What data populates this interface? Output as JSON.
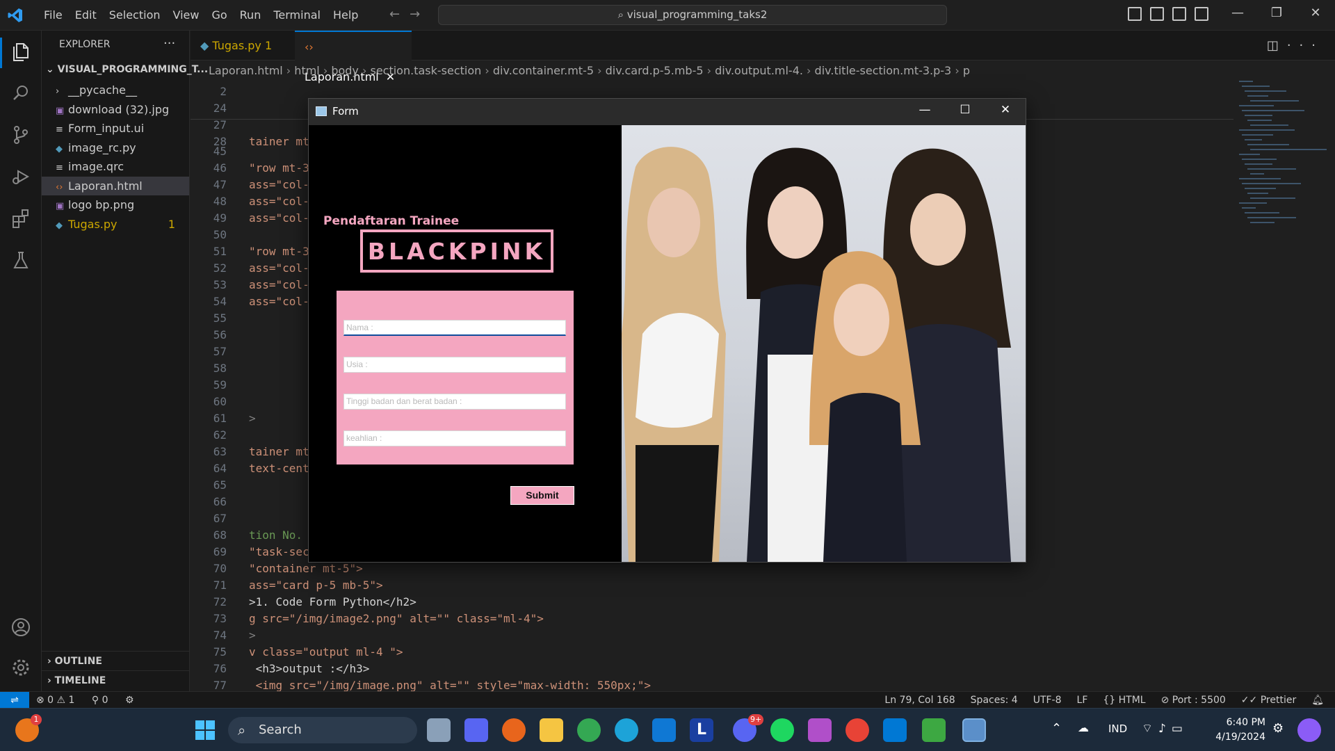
{
  "app": {
    "menu": [
      "File",
      "Edit",
      "Selection",
      "View",
      "Go",
      "Run",
      "Terminal",
      "Help"
    ],
    "search_text": "visual_programming_taks2"
  },
  "sidebar": {
    "header": "EXPLORER",
    "project": "VISUAL_PROGRAMMING_T...",
    "files": [
      {
        "name": "__pycache__",
        "icon": "chevron-right",
        "badge": ""
      },
      {
        "name": "download (32).jpg",
        "icon": "image",
        "badge": ""
      },
      {
        "name": "Form_input.ui",
        "icon": "lines",
        "badge": ""
      },
      {
        "name": "image_rc.py",
        "icon": "python",
        "badge": ""
      },
      {
        "name": "image.qrc",
        "icon": "lines",
        "badge": ""
      },
      {
        "name": "Laporan.html",
        "icon": "html",
        "badge": ""
      },
      {
        "name": "logo bp.png",
        "icon": "image",
        "badge": ""
      },
      {
        "name": "Tugas.py",
        "icon": "python",
        "badge": "1"
      }
    ],
    "outline": "OUTLINE",
    "timeline": "TIMELINE"
  },
  "tabs": [
    {
      "label": "Tugas.py 1"
    },
    {
      "label": "Laporan.html"
    }
  ],
  "breadcrumb": [
    "Laporan.html",
    "html",
    "body",
    "section.task-section",
    "div.container.mt-5",
    "div.card.p-5.mb-5",
    "div.output.ml-4.",
    "div.title-section.mt-3.p-3",
    "p"
  ],
  "code_lines": [
    {
      "n": "2",
      "t": ""
    },
    {
      "n": "24",
      "t": ""
    },
    {
      "n": "27",
      "t": ""
    },
    {
      "n": "28",
      "t": "tainer mt"
    },
    {
      "n": "45",
      "t": ""
    },
    {
      "n": "46",
      "t": "\"row mt-3"
    },
    {
      "n": "47",
      "t": "ass=\"col-"
    },
    {
      "n": "48",
      "t": "ass=\"col-"
    },
    {
      "n": "49",
      "t": "ass=\"col-"
    },
    {
      "n": "50",
      "t": ""
    },
    {
      "n": "51",
      "t": "\"row mt-3"
    },
    {
      "n": "52",
      "t": "ass=\"col-"
    },
    {
      "n": "53",
      "t": "ass=\"col-"
    },
    {
      "n": "54",
      "t": "ass=\"col-"
    },
    {
      "n": "55",
      "t": ""
    },
    {
      "n": "56",
      "t": ""
    },
    {
      "n": "57",
      "t": ""
    },
    {
      "n": "58",
      "t": ""
    },
    {
      "n": "59",
      "t": ""
    },
    {
      "n": "60",
      "t": ""
    },
    {
      "n": "61",
      "t": ">"
    },
    {
      "n": "62",
      "t": ""
    },
    {
      "n": "63",
      "t": "tainer mt"
    },
    {
      "n": "64",
      "t": "text-cent"
    },
    {
      "n": "65",
      "t": ""
    },
    {
      "n": "66",
      "t": ""
    },
    {
      "n": "67",
      "t": ""
    },
    {
      "n": "68",
      "t": "tion No."
    },
    {
      "n": "69",
      "t": "\"task-sec"
    },
    {
      "n": "70",
      "t": "\"container mt-5\">"
    },
    {
      "n": "71",
      "t": "ass=\"card p-5 mb-5\">"
    },
    {
      "n": "72",
      "t": ">1. Code Form Python</h2>"
    },
    {
      "n": "73",
      "t": "g src=\"/img/image2.png\" alt=\"\" class=\"ml-4\">"
    },
    {
      "n": "74",
      "t": ">"
    },
    {
      "n": "75",
      "t": "v class=\"output ml-4 \">"
    },
    {
      "n": "76",
      "t": " <h3>output :</h3>"
    },
    {
      "n": "77",
      "t": " <img src=\"/img/image.png\" alt=\"\" style=\"max-width: 550px;\">"
    }
  ],
  "status": {
    "problems": "⊗ 0 ⚠ 1",
    "ports": "⚲ 0",
    "position": "Ln 79, Col 168",
    "spaces": "Spaces: 4",
    "encoding": "UTF-8",
    "eol": "LF",
    "language": "HTML",
    "port": "Port : 5500",
    "prettier": "Prettier"
  },
  "taskbar": {
    "search": "Search",
    "lang": "IND",
    "time": "6:40 PM",
    "date": "4/19/2024",
    "notif_badge": "1",
    "discord_badge": "9+"
  },
  "form_window": {
    "title": "Form",
    "heading": "Pendaftaran Trainee",
    "logo_text": "BLACKPINK",
    "fields": [
      {
        "placeholder": "Nama :"
      },
      {
        "placeholder": "Usia :"
      },
      {
        "placeholder": "Tinggi badan dan berat badan :"
      },
      {
        "placeholder": "keahlian :"
      }
    ],
    "submit": "Submit"
  },
  "colors": {
    "accent": "#0078d4",
    "pink": "#f4a6c0",
    "modified": "#cca700"
  }
}
